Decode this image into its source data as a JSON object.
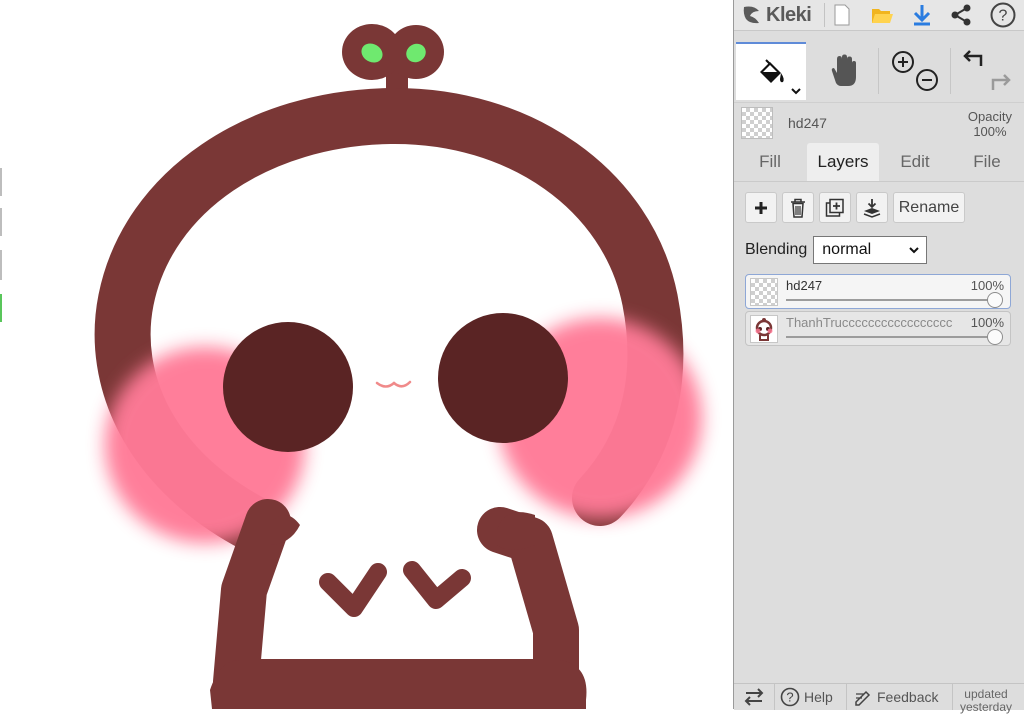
{
  "app": {
    "name": "Kleki"
  },
  "toolbar": {
    "new_icon": "new-document-icon",
    "open_icon": "open-folder-icon",
    "save_icon": "download-icon",
    "share_icon": "share-icon",
    "help_icon": "help-icon"
  },
  "tools": {
    "active": "fill",
    "items": [
      "paint-bucket-icon",
      "hand-icon",
      "zoom-in-icon",
      "zoom-out-icon",
      "undo-icon",
      "redo-icon"
    ]
  },
  "current_layer": {
    "name": "hd247",
    "opacity_label": "Opacity",
    "opacity_value": "100%"
  },
  "tabs": [
    {
      "label": "Fill",
      "active": false
    },
    {
      "label": "Layers",
      "active": true
    },
    {
      "label": "Edit",
      "active": false
    },
    {
      "label": "File",
      "active": false
    }
  ],
  "layer_actions": {
    "rename_label": "Rename"
  },
  "blending": {
    "label": "Blending",
    "selected": "normal"
  },
  "layers": [
    {
      "name": "hd247",
      "opacity": "100%",
      "opacity_fraction": 1.0,
      "selected": true
    },
    {
      "name": "ThanhTruccccccccccccccccc",
      "opacity": "100%",
      "opacity_fraction": 1.0,
      "selected": false
    }
  ],
  "bottom": {
    "help_label": "Help",
    "feedback_label": "Feedback",
    "updated_label": "updated yesterday"
  },
  "colors": {
    "outline": "#7a3736",
    "eyes": "#5a2424",
    "cheeks": "#ff7a97",
    "sprout_leaf": "#6fe96f",
    "accent": "#5f8bd8"
  }
}
